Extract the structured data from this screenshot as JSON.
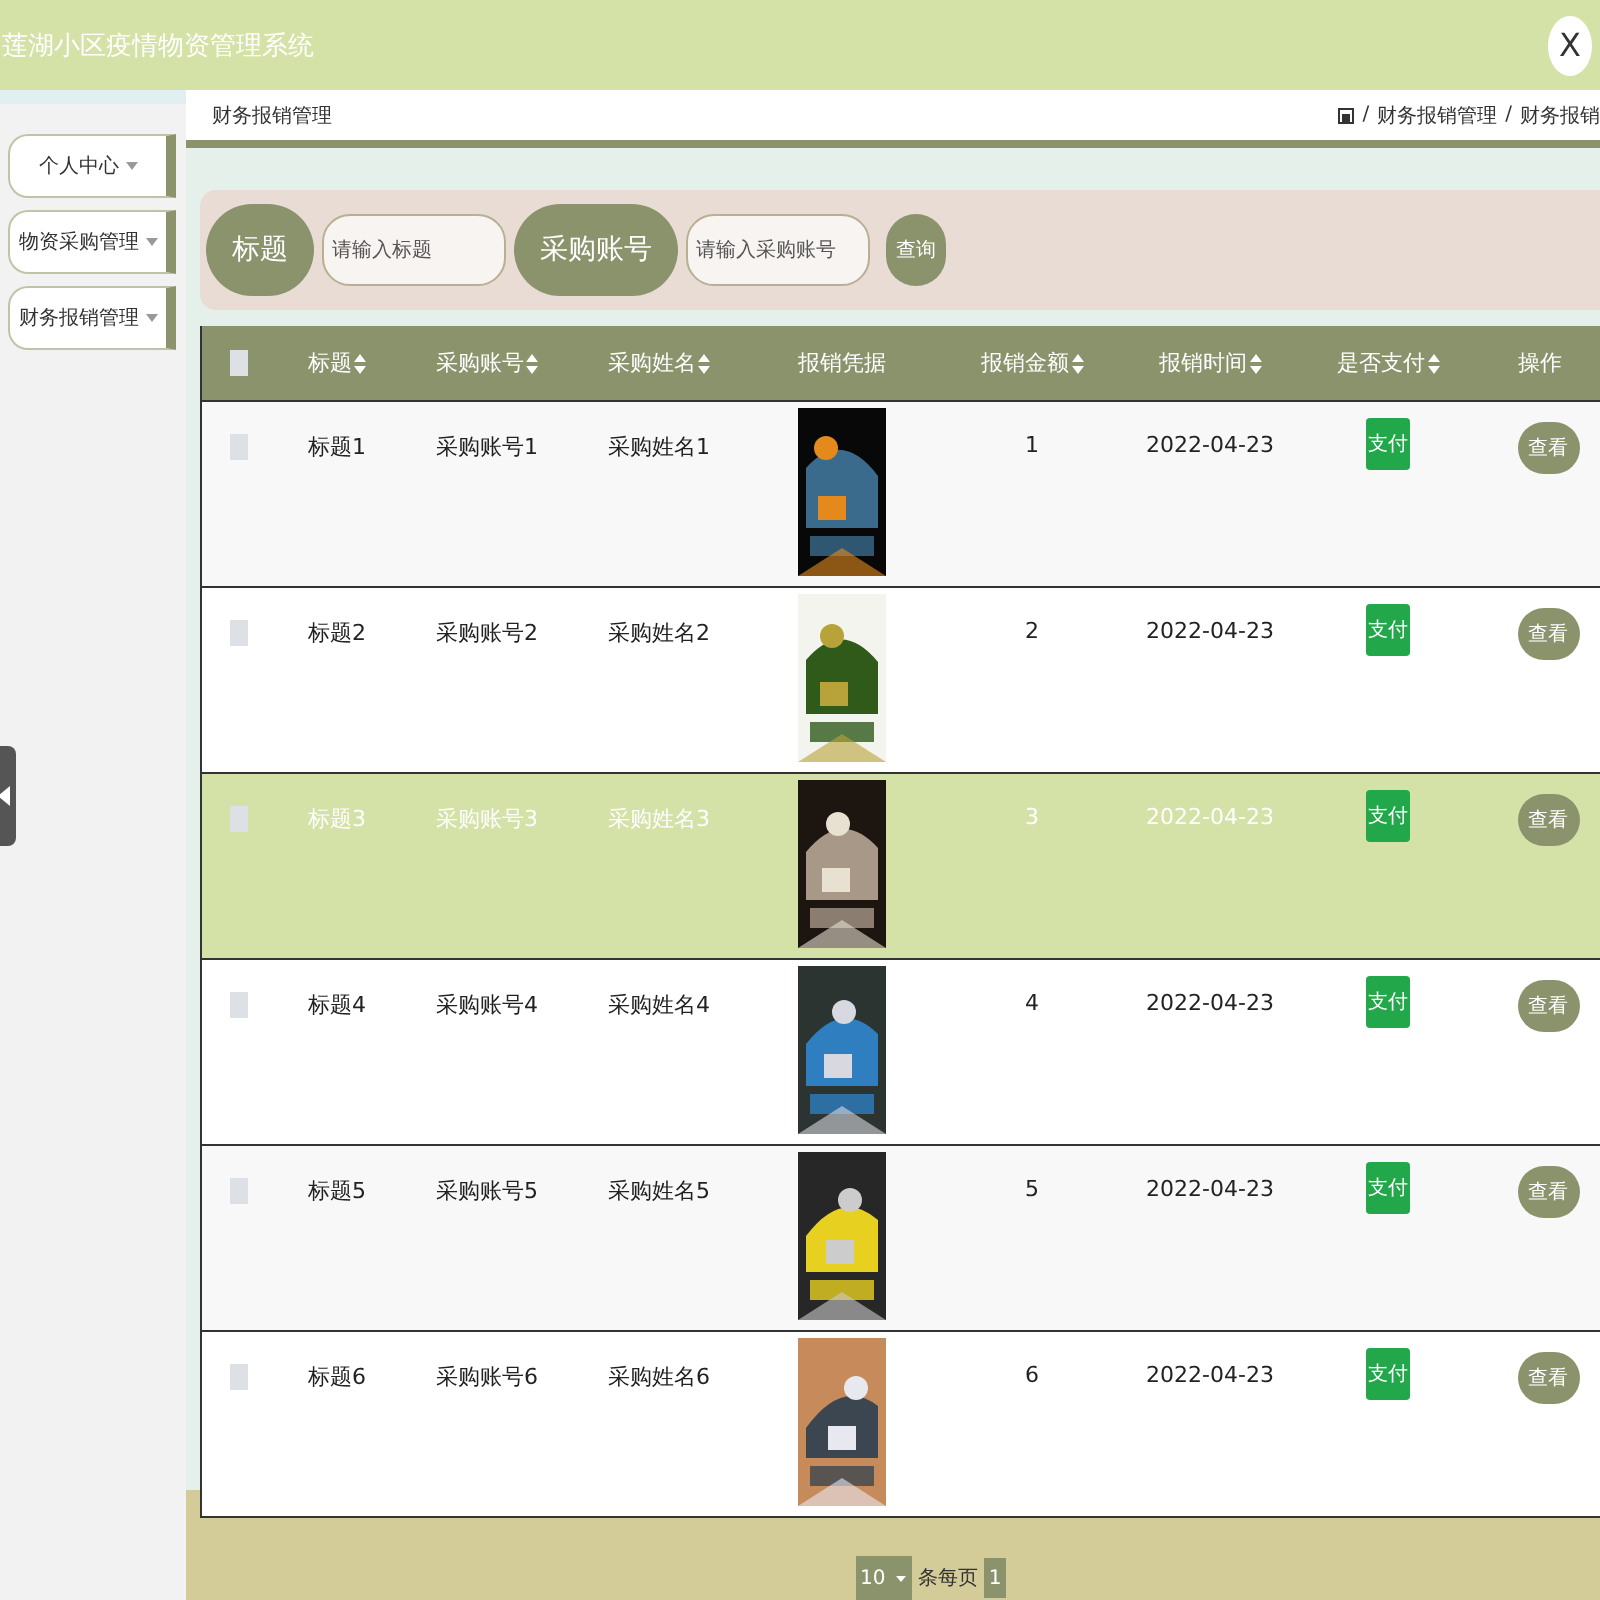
{
  "app": {
    "title": "莲湖小区疫情物资管理系统",
    "close": "X"
  },
  "sidebar": {
    "items": [
      {
        "label": "个人中心",
        "expanded": false
      },
      {
        "label": "物资采购管理",
        "expanded": false
      },
      {
        "label": "财务报销管理",
        "expanded": false
      }
    ]
  },
  "breadcrumb": {
    "page_title": "财务报销管理",
    "separator": "/",
    "path": [
      "财务报销管理",
      "财务报销"
    ]
  },
  "search": {
    "fields": [
      {
        "label": "标题",
        "placeholder": "请输入标题"
      },
      {
        "label": "采购账号",
        "placeholder": "请输入采购账号"
      }
    ],
    "button": "查询"
  },
  "table": {
    "all_checked": false,
    "columns": [
      {
        "label": "标题",
        "sortable": true
      },
      {
        "label": "采购账号",
        "sortable": true
      },
      {
        "label": "采购姓名",
        "sortable": true
      },
      {
        "label": "报销凭据",
        "sortable": false
      },
      {
        "label": "报销金额",
        "sortable": true
      },
      {
        "label": "报销时间",
        "sortable": true
      },
      {
        "label": "是否支付",
        "sortable": true
      },
      {
        "label": "操作",
        "sortable": false
      }
    ],
    "rows": [
      {
        "checked": false,
        "highlighted": false,
        "title": "标题1",
        "account": "采购账号1",
        "name": "采购姓名1",
        "amount": "1",
        "date": "2022-04-23",
        "pay": "支付",
        "view": "查看"
      },
      {
        "checked": false,
        "highlighted": false,
        "title": "标题2",
        "account": "采购账号2",
        "name": "采购姓名2",
        "amount": "2",
        "date": "2022-04-23",
        "pay": "支付",
        "view": "查看"
      },
      {
        "checked": false,
        "highlighted": true,
        "title": "标题3",
        "account": "采购账号3",
        "name": "采购姓名3",
        "amount": "3",
        "date": "2022-04-23",
        "pay": "支付",
        "view": "查看"
      },
      {
        "checked": false,
        "highlighted": false,
        "title": "标题4",
        "account": "采购账号4",
        "name": "采购姓名4",
        "amount": "4",
        "date": "2022-04-23",
        "pay": "支付",
        "view": "查看"
      },
      {
        "checked": false,
        "highlighted": false,
        "title": "标题5",
        "account": "采购账号5",
        "name": "采购姓名5",
        "amount": "5",
        "date": "2022-04-23",
        "pay": "支付",
        "view": "查看"
      },
      {
        "checked": false,
        "highlighted": false,
        "title": "标题6",
        "account": "采购账号6",
        "name": "采购姓名6",
        "amount": "6",
        "date": "2022-04-23",
        "pay": "支付",
        "view": "查看"
      }
    ]
  },
  "pagination": {
    "page_size": "10",
    "per_page_label": "条每页",
    "pages": [
      {
        "label": "1",
        "selected": true
      }
    ]
  }
}
